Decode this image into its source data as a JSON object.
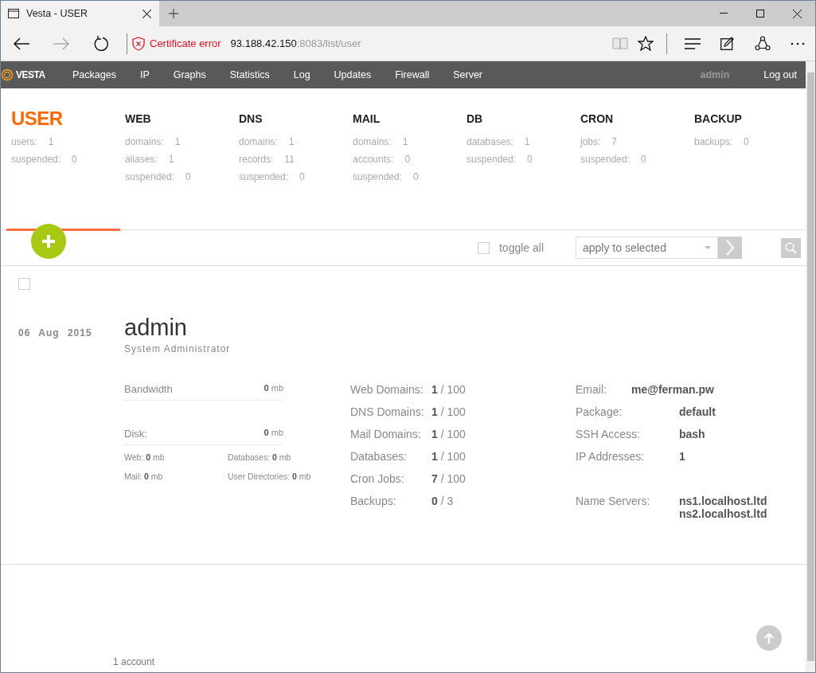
{
  "browser": {
    "tab_title": "Vesta - USER",
    "cert_error": "Certificate error",
    "url_host": "93.188.42.150",
    "url_rest": ":8083/list/user"
  },
  "nav": {
    "logo": "VESTA",
    "items": [
      "Packages",
      "IP",
      "Graphs",
      "Statistics",
      "Log",
      "Updates",
      "Firewall",
      "Server"
    ],
    "user": "admin",
    "logout": "Log out"
  },
  "stats": [
    {
      "title": "USER",
      "selected": true,
      "rows": [
        {
          "label": "users:",
          "value": "1"
        },
        {
          "label": "suspended:",
          "value": "0"
        }
      ]
    },
    {
      "title": "WEB",
      "selected": false,
      "rows": [
        {
          "label": "domains:",
          "value": "1"
        },
        {
          "label": "aliases:",
          "value": "1"
        },
        {
          "label": "suspended:",
          "value": "0"
        }
      ]
    },
    {
      "title": "DNS",
      "selected": false,
      "rows": [
        {
          "label": "domains:",
          "value": "1"
        },
        {
          "label": "records:",
          "value": "11"
        },
        {
          "label": "suspended:",
          "value": "0"
        }
      ]
    },
    {
      "title": "MAIL",
      "selected": false,
      "rows": [
        {
          "label": "domains:",
          "value": "1"
        },
        {
          "label": "accounts:",
          "value": "0"
        },
        {
          "label": "suspended:",
          "value": "0"
        }
      ]
    },
    {
      "title": "DB",
      "selected": false,
      "rows": [
        {
          "label": "databases:",
          "value": "1"
        },
        {
          "label": "suspended:",
          "value": "0"
        }
      ]
    },
    {
      "title": "CRON",
      "selected": false,
      "rows": [
        {
          "label": "jobs:",
          "value": "7"
        },
        {
          "label": "suspended:",
          "value": "0"
        }
      ]
    },
    {
      "title": "BACKUP",
      "selected": false,
      "rows": [
        {
          "label": "backups:",
          "value": "0"
        }
      ]
    }
  ],
  "toolbar": {
    "toggle_all": {
      "label": "toggle all",
      "checked": false
    },
    "action": {
      "placeholder": "apply to selected"
    }
  },
  "user": {
    "checked": false,
    "date": "06 Aug 2015",
    "name": "admin",
    "role": "System Administrator",
    "bandwidth": {
      "label": "Bandwidth",
      "value": "**0** mb"
    },
    "disk": {
      "label": "Disk:",
      "value": "**0** mb"
    },
    "disk_breakdown": [
      {
        "text": "Web: **0** mb"
      },
      {
        "text": "Databases: **0** mb"
      },
      {
        "text": "Mail: **0** mb"
      },
      {
        "text": "User Directories: **0** mb"
      }
    ],
    "limits": [
      {
        "label": "Web Domains:",
        "value": "**1** / 100"
      },
      {
        "label": "DNS Domains:",
        "value": "**1** / 100"
      },
      {
        "label": "Mail Domains:",
        "value": "**1** / 100"
      },
      {
        "label": "Databases:",
        "value": "**1** / 100"
      },
      {
        "label": "Cron Jobs:",
        "value": "**7** / 100"
      },
      {
        "label": "Backups:",
        "value": "**0** / 3"
      }
    ],
    "details": [
      {
        "kind": "email",
        "label": "Email:",
        "value": "me@ferman.pw"
      },
      {
        "kind": "field",
        "label": "Package:",
        "value": "default"
      },
      {
        "kind": "field",
        "label": "SSH Access:",
        "value": "bash"
      },
      {
        "kind": "field",
        "label": "IP Addresses:",
        "value": "1"
      }
    ],
    "name_servers": {
      "label": "Name Servers:",
      "values": [
        "ns1.localhost.ltd",
        "ns2.localhost.ltd"
      ]
    }
  },
  "footer": {
    "count": "1 account"
  }
}
